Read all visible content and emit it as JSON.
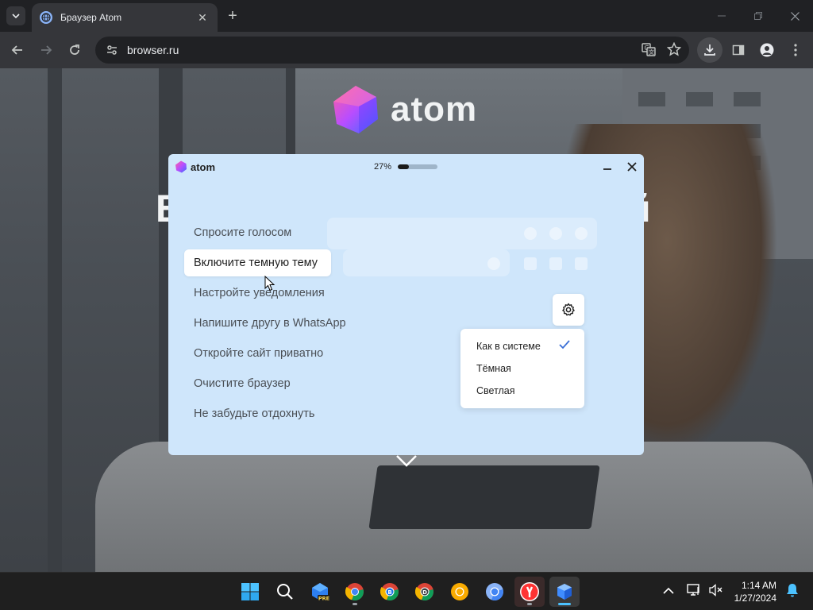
{
  "browser": {
    "tab_title": "Браузер Atom",
    "url": "browser.ru"
  },
  "page": {
    "logo_text": "atom",
    "headline_left": "Б",
    "headline_right": "й"
  },
  "popup": {
    "logo_text": "atom",
    "progress_label": "27%",
    "progress_value": 0.27,
    "tips": [
      {
        "label": "Спросите голосом"
      },
      {
        "label": "Включите темную тему"
      },
      {
        "label": "Настройте уведомления"
      },
      {
        "label": "Напишите другу в WhatsApp"
      },
      {
        "label": "Откройте сайт приватно"
      },
      {
        "label": "Очистите браузер"
      },
      {
        "label": "Не забудьте отдохнуть"
      }
    ],
    "theme_menu": {
      "options": [
        {
          "label": "Как в системе",
          "selected": true
        },
        {
          "label": "Тёмная",
          "selected": false
        },
        {
          "label": "Светлая",
          "selected": false
        }
      ]
    }
  },
  "taskbar": {
    "apps": [
      "start-icon",
      "search-icon",
      "edge-dev-icon",
      "chrome-icon",
      "chrome-beta-icon",
      "chrome-dev-icon",
      "chrome-canary-icon",
      "chromium-icon",
      "yandex-icon",
      "atom-browser-icon"
    ],
    "pre_badge": "PRE",
    "chrome_beta_letter": "B",
    "chrome_dev_letter": "D",
    "time": "1:14 AM",
    "date": "1/27/2024"
  },
  "colors": {
    "popup_bg": "#cfe6fb",
    "chrome_dark": "#202124",
    "taskbar_bg": "#1f1f1f",
    "accent_blue": "#4cc2ff"
  }
}
